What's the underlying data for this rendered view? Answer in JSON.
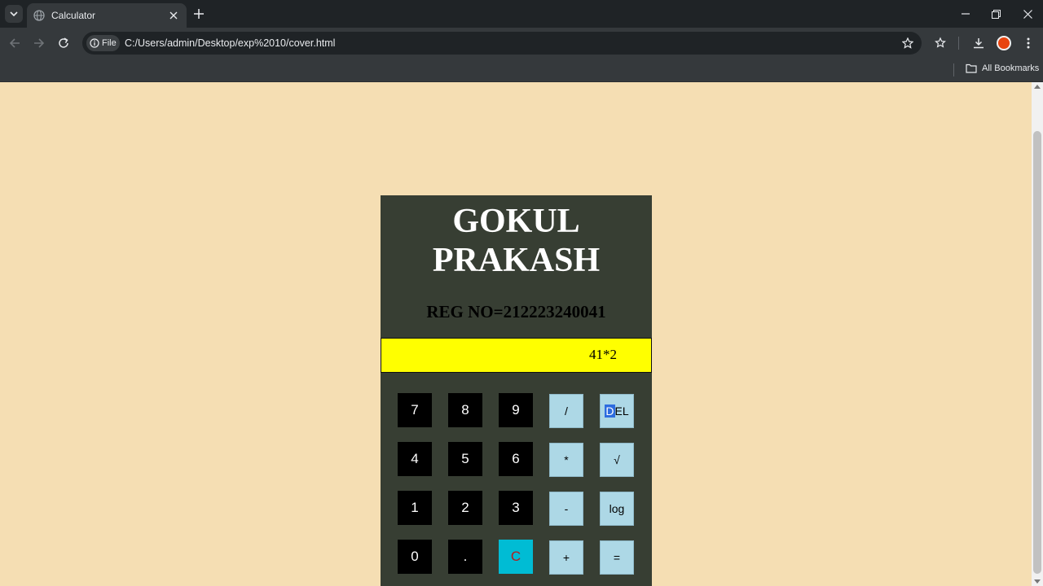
{
  "browser": {
    "tab_title": "Calculator",
    "chip_label": "File",
    "url": "C:/Users/admin/Desktop/exp%2010/cover.html",
    "bookmarks_label": "All Bookmarks"
  },
  "calculator": {
    "name_line1": "GOKUL",
    "name_line2": "PRAKASH",
    "reg_no": "REG NO=212223240041",
    "display_value": "41*2",
    "keys": {
      "k7": "7",
      "k8": "8",
      "k9": "9",
      "div": "/",
      "del_first": "D",
      "del_rest": "EL",
      "k4": "4",
      "k5": "5",
      "k6": "6",
      "mul": "*",
      "sqrt": "√",
      "k1": "1",
      "k2": "2",
      "k3": "3",
      "sub": "-",
      "log": "log",
      "k0": "0",
      "dot": ".",
      "clear": "C",
      "add": "+",
      "eq": "="
    }
  },
  "colors": {
    "page_bg": "#f5deb3",
    "calc_bg": "#373e33",
    "display_bg": "#ffff00",
    "number_key_bg": "#000000",
    "operator_key_bg": "#add8e6",
    "clear_key_bg": "#00bcd4"
  }
}
